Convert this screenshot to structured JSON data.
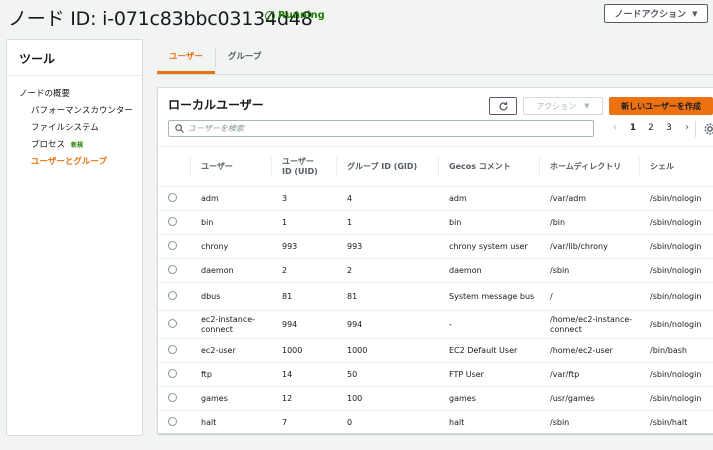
{
  "header": {
    "title": "ノード ID: i-071c83bbc03134d48",
    "status": "Running",
    "node_action_label": "ノードアクション"
  },
  "sidebar": {
    "title": "ツール",
    "items": [
      {
        "label": "ノードの概要"
      },
      {
        "label": "パフォーマンスカウンター"
      },
      {
        "label": "ファイルシステム"
      },
      {
        "label": "プロセス",
        "badge": "新規"
      },
      {
        "label": "ユーザーとグループ"
      }
    ]
  },
  "tabs": [
    {
      "label": "ユーザー"
    },
    {
      "label": "グループ"
    }
  ],
  "panel": {
    "title": "ローカルユーザー",
    "action_label": "アクション",
    "create_label": "新しいユーザーを作成",
    "search_placeholder": "ユーザーを検索",
    "pages": [
      "1",
      "2",
      "3"
    ]
  },
  "table": {
    "columns": [
      "ユーザー",
      "ユーザー ID (UID)",
      "グループ ID (GID)",
      "Gecos コメント",
      "ホームディレクトリ",
      "シェル"
    ],
    "rows": [
      {
        "user": "adm",
        "uid": "3",
        "gid": "4",
        "gecos": "adm",
        "home": "/var/adm",
        "shell": "/sbin/nologin"
      },
      {
        "user": "bin",
        "uid": "1",
        "gid": "1",
        "gecos": "bin",
        "home": "/bin",
        "shell": "/sbin/nologin"
      },
      {
        "user": "chrony",
        "uid": "993",
        "gid": "993",
        "gecos": "chrony system user",
        "home": "/var/lib/chrony",
        "shell": "/sbin/nologin"
      },
      {
        "user": "daemon",
        "uid": "2",
        "gid": "2",
        "gecos": "daemon",
        "home": "/sbin",
        "shell": "/sbin/nologin"
      },
      {
        "user": "dbus",
        "uid": "81",
        "gid": "81",
        "gecos": "System message bus",
        "home": "/",
        "shell": "/sbin/nologin"
      },
      {
        "user": "ec2-instance-connect",
        "uid": "994",
        "gid": "994",
        "gecos": "-",
        "home": "/home/ec2-instance-connect",
        "shell": "/sbin/nologin"
      },
      {
        "user": "ec2-user",
        "uid": "1000",
        "gid": "1000",
        "gecos": "EC2 Default User",
        "home": "/home/ec2-user",
        "shell": "/bin/bash"
      },
      {
        "user": "ftp",
        "uid": "14",
        "gid": "50",
        "gecos": "FTP User",
        "home": "/var/ftp",
        "shell": "/sbin/nologin"
      },
      {
        "user": "games",
        "uid": "12",
        "gid": "100",
        "gecos": "games",
        "home": "/usr/games",
        "shell": "/sbin/nologin"
      },
      {
        "user": "halt",
        "uid": "7",
        "gid": "0",
        "gecos": "halt",
        "home": "/sbin",
        "shell": "/sbin/halt"
      }
    ]
  }
}
